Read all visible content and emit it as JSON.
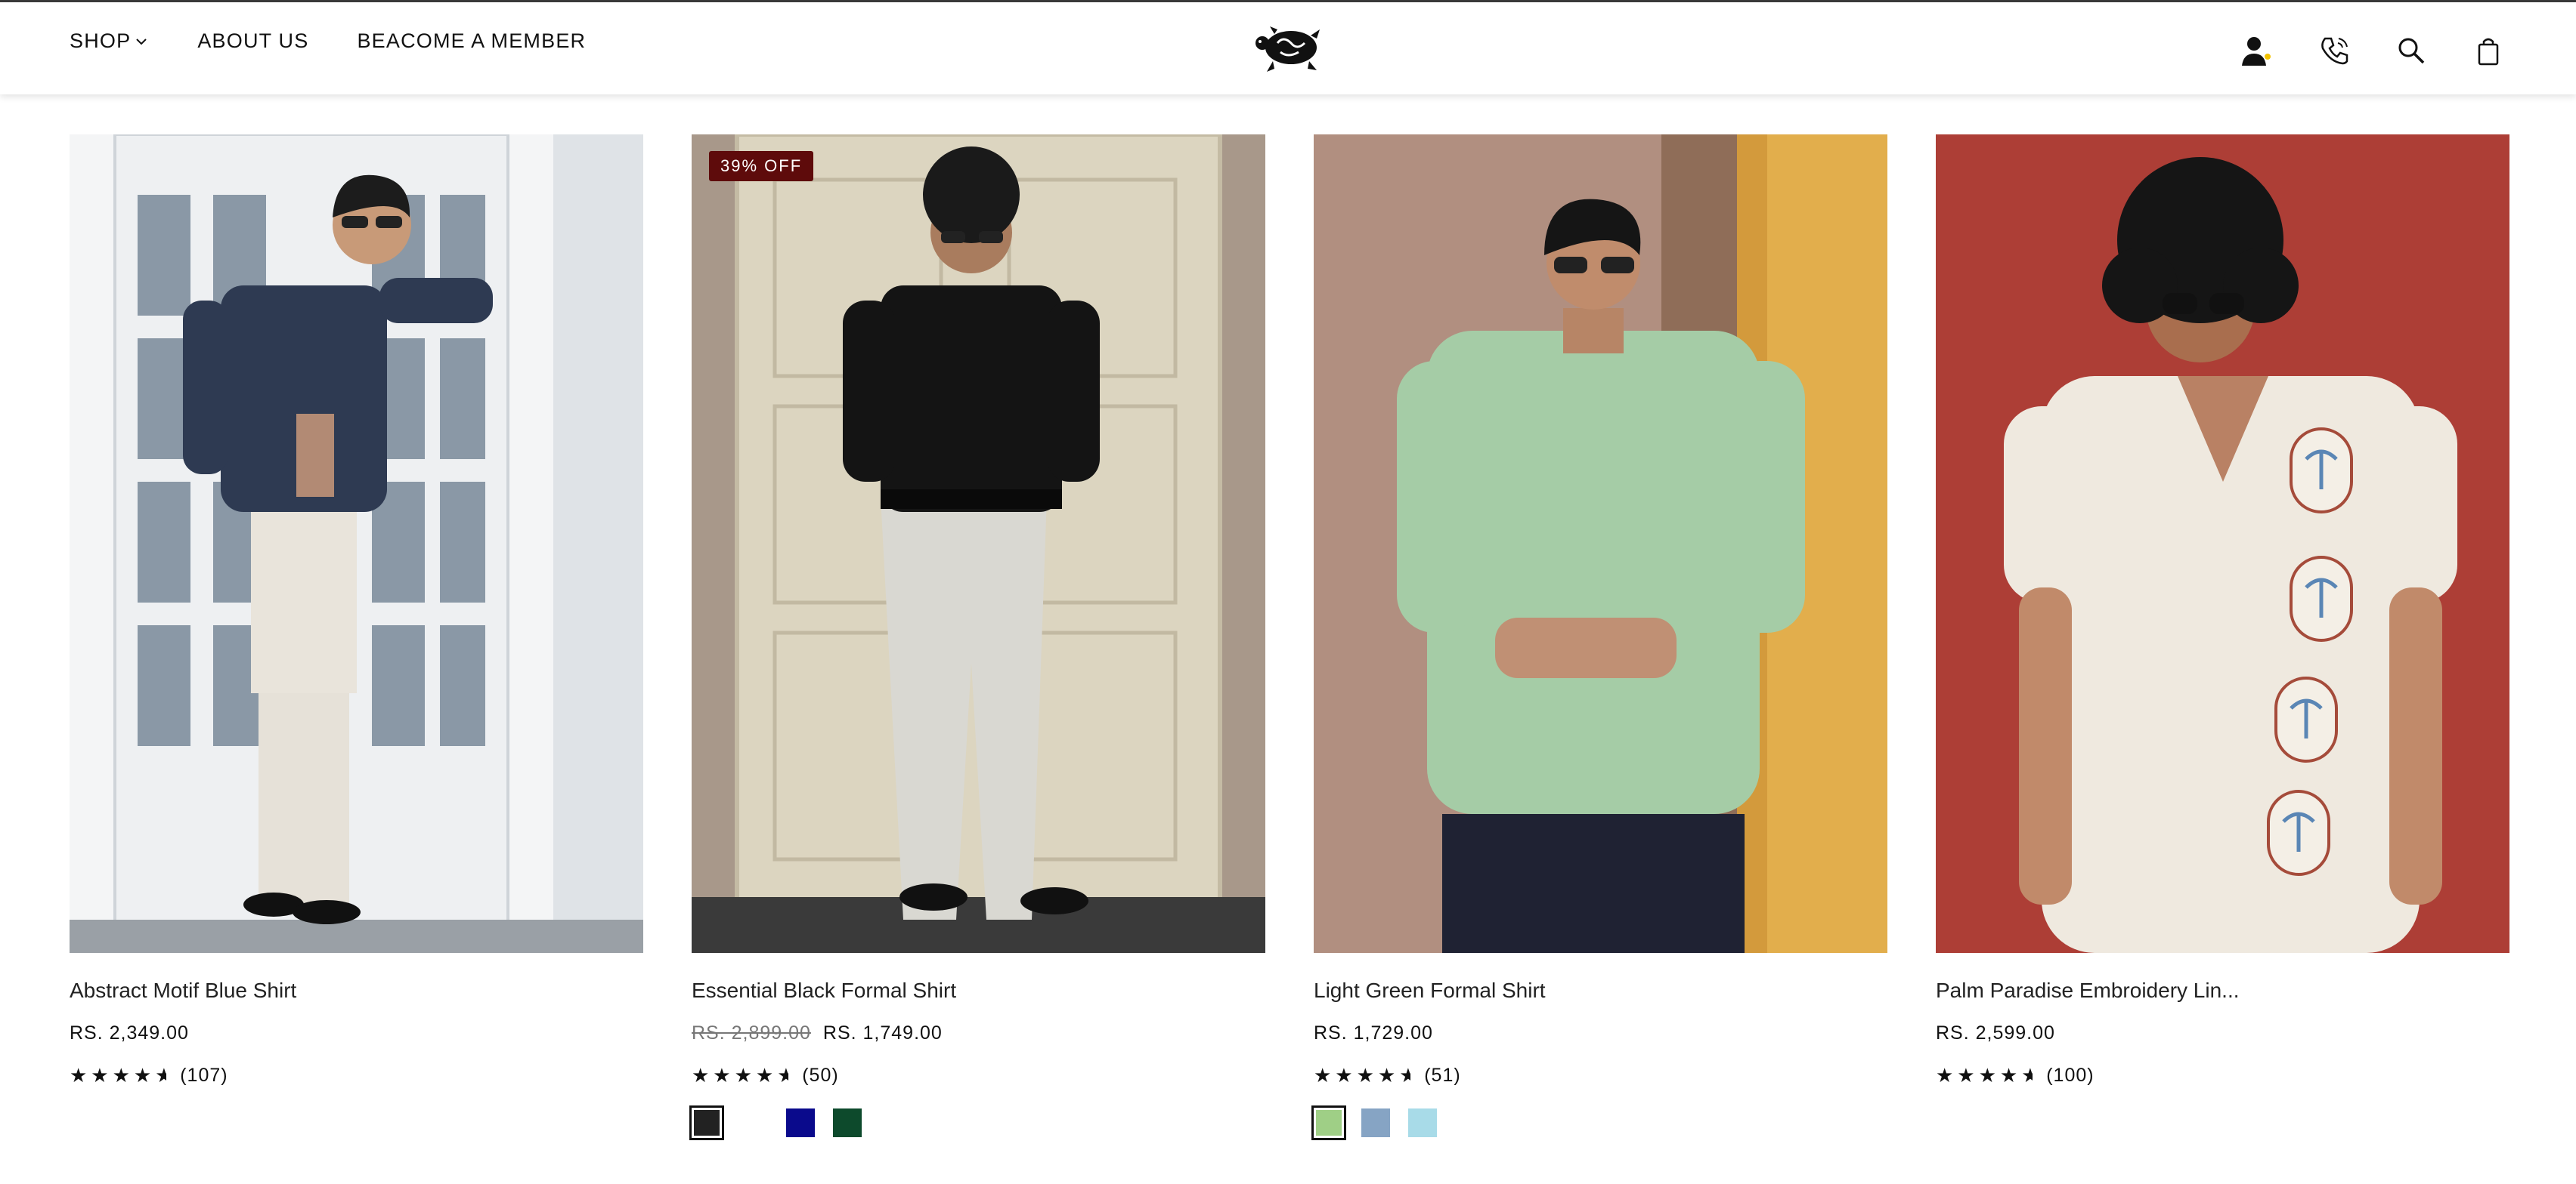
{
  "nav": {
    "items": [
      {
        "label": "SHOP"
      },
      {
        "label": "ABOUT US"
      },
      {
        "label": "BEACOME A MEMBER"
      }
    ]
  },
  "icons": [
    "account-icon",
    "phone-icon",
    "search-icon",
    "bag-icon"
  ],
  "products": [
    {
      "name": "Abstract Motif Blue Shirt",
      "badge": "",
      "old_price": "",
      "price": "RS. 2,349.00",
      "rating": 4.5,
      "review_count": "(107)",
      "swatches": []
    },
    {
      "name": "Essential Black Formal Shirt",
      "badge": "39% OFF",
      "old_price": "RS. 2,899.00",
      "price": "RS. 1,749.00",
      "rating": 4.5,
      "review_count": "(50)",
      "swatches": [
        "#222222",
        "#ffffff",
        "#0a0a8c",
        "#0d4a2c"
      ]
    },
    {
      "name": "Light Green Formal Shirt",
      "badge": "",
      "old_price": "",
      "price": "RS. 1,729.00",
      "rating": 4.5,
      "review_count": "(51)",
      "swatches": [
        "#9fcf86",
        "#86a4c4",
        "#a8dbe8"
      ]
    },
    {
      "name": "Palm Paradise Embroidery Lin...",
      "badge": "",
      "old_price": "",
      "price": "RS. 2,599.00",
      "rating": 4.5,
      "review_count": "(100)",
      "swatches": []
    }
  ],
  "colors": {
    "badge": "#5e0b0b",
    "text": "#111111"
  }
}
